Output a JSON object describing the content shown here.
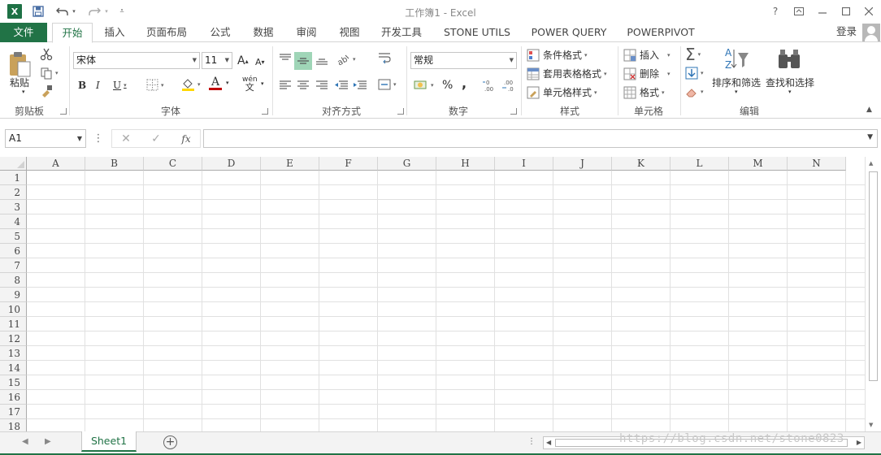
{
  "window": {
    "title": "工作簿1 - Excel",
    "help_icon": "?",
    "app_logo": "X"
  },
  "ribbon_tabs": [
    {
      "label": "文件"
    },
    {
      "label": "开始"
    },
    {
      "label": "插入"
    },
    {
      "label": "页面布局"
    },
    {
      "label": "公式"
    },
    {
      "label": "数据"
    },
    {
      "label": "审阅"
    },
    {
      "label": "视图"
    },
    {
      "label": "开发工具"
    },
    {
      "label": "STONE UTILS"
    },
    {
      "label": "POWER QUERY"
    },
    {
      "label": "POWERPIVOT"
    }
  ],
  "account": {
    "login_label": "登录"
  },
  "clipboard": {
    "paste_label": "粘贴",
    "group_label": "剪贴板"
  },
  "font": {
    "name_value": "宋体",
    "size_value": "11",
    "grow_label": "A",
    "shrink_label": "A",
    "bold_label": "B",
    "italic_label": "I",
    "underline_label": "U",
    "phonetic_label": "wén",
    "phonetic_char": "文",
    "font_color_label": "A",
    "group_label": "字体",
    "font_color": "#c00000",
    "fill_color": "#ffff00"
  },
  "alignment": {
    "group_label": "对齐方式"
  },
  "number": {
    "format_value": "常规",
    "percent_label": "%",
    "comma_label": ",",
    "group_label": "数字"
  },
  "styles": {
    "conditional_label": "条件格式",
    "table_label": "套用表格格式",
    "cell_styles_label": "单元格样式",
    "group_label": "样式"
  },
  "cells": {
    "insert_label": "插入",
    "delete_label": "删除",
    "format_label": "格式",
    "group_label": "单元格"
  },
  "editing": {
    "sort_filter_label": "排序和筛选",
    "find_select_label": "查找和选择",
    "group_label": "编辑",
    "sigma_label": "Σ"
  },
  "formula_bar": {
    "name_box_value": "A1",
    "cancel_label": "✕",
    "enter_label": "✓",
    "fx_label": "fx",
    "formula_value": ""
  },
  "grid": {
    "columns": [
      "A",
      "B",
      "C",
      "D",
      "E",
      "F",
      "G",
      "H",
      "I",
      "J",
      "K",
      "L",
      "M",
      "N"
    ],
    "rows": [
      "1",
      "2",
      "3",
      "4",
      "5",
      "6",
      "7",
      "8",
      "9",
      "10",
      "11",
      "12",
      "13",
      "14",
      "15",
      "16",
      "17",
      "18"
    ]
  },
  "sheets": {
    "tabs": [
      {
        "label": "Sheet1",
        "active": true
      }
    ],
    "add_label": "+"
  },
  "watermark": "https://blog.csdn.net/stone0823",
  "colors": {
    "accent": "#217346",
    "gridline": "#e1e1e1",
    "header_bg": "#f3f3f3"
  }
}
